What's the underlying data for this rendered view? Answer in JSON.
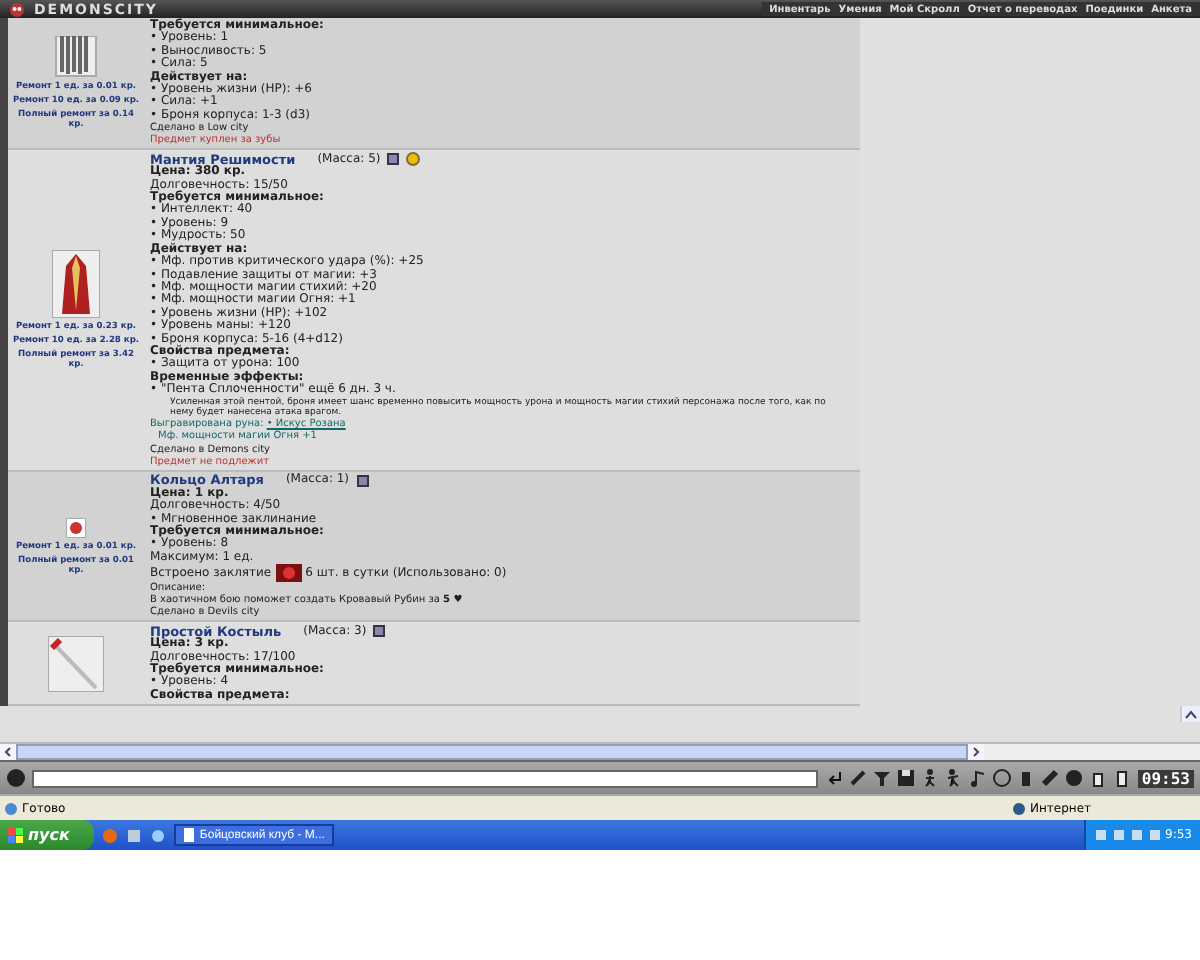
{
  "header": {
    "logo": "DEMONSCITY",
    "nav": [
      "Инвентарь",
      "Умения",
      "Мой Скролл",
      "Отчет о переводах",
      "Поединки",
      "Анкета"
    ]
  },
  "items": [
    {
      "kind": "fabric",
      "repair": [
        "Ремонт 1 ед. за 0.01 кр.",
        "Ремонт 10 ед. за 0.09 кр.",
        "Полный ремонт за 0.14 кр."
      ],
      "lines": [
        {
          "kind": "heading",
          "text": "Требуется минимальное:"
        },
        {
          "kind": "plain",
          "text": "• Уровень: 1"
        },
        {
          "kind": "plain",
          "text": "• Выносливость: 5"
        },
        {
          "kind": "plain",
          "text": "• Сила: 5"
        },
        {
          "kind": "heading",
          "text": "Действует на:"
        },
        {
          "kind": "plain",
          "text": "• Уровень жизни (HP): +6"
        },
        {
          "kind": "plain",
          "text": "• Сила: +1"
        },
        {
          "kind": "plain",
          "text": "• Броня корпуса: 1-3 (d3)"
        },
        {
          "kind": "small",
          "text": "Сделано в Low city"
        },
        {
          "kind": "red",
          "text": "Предмет куплен за зубы"
        }
      ]
    },
    {
      "kind": "robe",
      "name": "Мантия Решимости",
      "mass": "(Масса: 5)",
      "badges": [
        {
          "kind": "box"
        },
        {
          "kind": "coin"
        }
      ],
      "repair": [
        "Ремонт 1 ед. за 0.23 кр.",
        "Ремонт 10 ед. за 2.28 кр.",
        "Полный ремонт за 3.42 кр."
      ],
      "lines": [
        {
          "kind": "heading",
          "text": "Цена: 380 кр."
        },
        {
          "kind": "plain",
          "text": "Долговечность: 15/50"
        },
        {
          "kind": "heading",
          "text": "Требуется минимальное:"
        },
        {
          "kind": "plain",
          "text": "• Интеллект: 40"
        },
        {
          "kind": "plain",
          "text": "• Уровень: 9"
        },
        {
          "kind": "plain",
          "text": "• Мудрость: 50"
        },
        {
          "kind": "heading",
          "text": "Действует на:"
        },
        {
          "kind": "plain",
          "text": "• Мф. против критического удара (%): +25"
        },
        {
          "kind": "plain",
          "text": "• Подавление защиты от магии: +3"
        },
        {
          "kind": "plain",
          "text": "• Мф. мощности магии стихий: +20"
        },
        {
          "kind": "plain",
          "text": "• Мф. мощности магии Огня: +1"
        },
        {
          "kind": "plain",
          "text": "• Уровень жизни (HP): +102"
        },
        {
          "kind": "plain",
          "text": "• Уровень маны: +120"
        },
        {
          "kind": "plain",
          "text": "• Броня корпуса: 5-16 (4+d12)"
        },
        {
          "kind": "heading",
          "text": "Свойства предмета:"
        },
        {
          "kind": "plain",
          "text": "• Защита от урона: 100"
        },
        {
          "kind": "heading",
          "text": "Временные эффекты:"
        },
        {
          "kind": "plain",
          "text": "• \"Пента Сплоченности\" ещё 6 дн. 3 ч."
        },
        {
          "kind": "note",
          "text": "Усиленная этой пентой, броня имеет шанс временно повысить мощность урона и мощность магии стихий персонажа после того, как по нему будет нанесена атака врагом."
        },
        {
          "kind": "rune",
          "text": "Выгравирована руна:",
          "link": "• Искус Розана"
        },
        {
          "kind": "rune_effect",
          "text": "Мф. мощности магии Огня +1"
        },
        {
          "kind": "small",
          "text": "Сделано в Demons city"
        },
        {
          "kind": "red",
          "text": "Предмет не подлежит"
        }
      ]
    },
    {
      "kind": "ring",
      "name": "Кольцо Алтаря",
      "mass": "(Масса: 1)",
      "badges": [
        {
          "kind": "box"
        }
      ],
      "repair": [
        "Ремонт 1 ед. за 0.01 кр.",
        "Полный ремонт за 0.01 кр."
      ],
      "lines": [
        {
          "kind": "heading",
          "text": "Цена: 1 кр."
        },
        {
          "kind": "plain",
          "text": "Долговечность: 4/50"
        },
        {
          "kind": "plain",
          "text": "• Мгновенное заклинание"
        },
        {
          "kind": "heading",
          "text": "Требуется минимальное:"
        },
        {
          "kind": "plain",
          "text": "• Уровень: 8"
        },
        {
          "kind": "plain",
          "text": "Максимум: 1 ед."
        },
        {
          "kind": "spell",
          "text": "Встроено заклятие",
          "after": "6 шт. в сутки (Использовано: 0)"
        },
        {
          "kind": "small",
          "text": "Описание:"
        },
        {
          "kind": "small",
          "text": "В хаотичном бою поможет создать Кровавый Рубин за **5 ♥**"
        },
        {
          "kind": "small",
          "text": "Сделано в Devils city"
        }
      ]
    },
    {
      "kind": "crutch",
      "name": "Простой Костыль",
      "mass": "(Масса: 3)",
      "badges": [
        {
          "kind": "box"
        }
      ],
      "lines": [
        {
          "kind": "heading",
          "text": "Цена: 3 кр."
        },
        {
          "kind": "plain",
          "text": "Долговечность: 17/100"
        },
        {
          "kind": "heading",
          "text": "Требуется минимальное:"
        },
        {
          "kind": "plain",
          "text": "• Уровень: 4"
        },
        {
          "kind": "heading",
          "text": "Свойства предмета:"
        }
      ]
    }
  ],
  "chat": {
    "clock": "09:53"
  },
  "status_bar": {
    "text": "Готово",
    "zone": "Интернет"
  },
  "taskbar": {
    "start": "пуск",
    "window": "Бойцовский клуб - M...",
    "time": "9:53"
  }
}
